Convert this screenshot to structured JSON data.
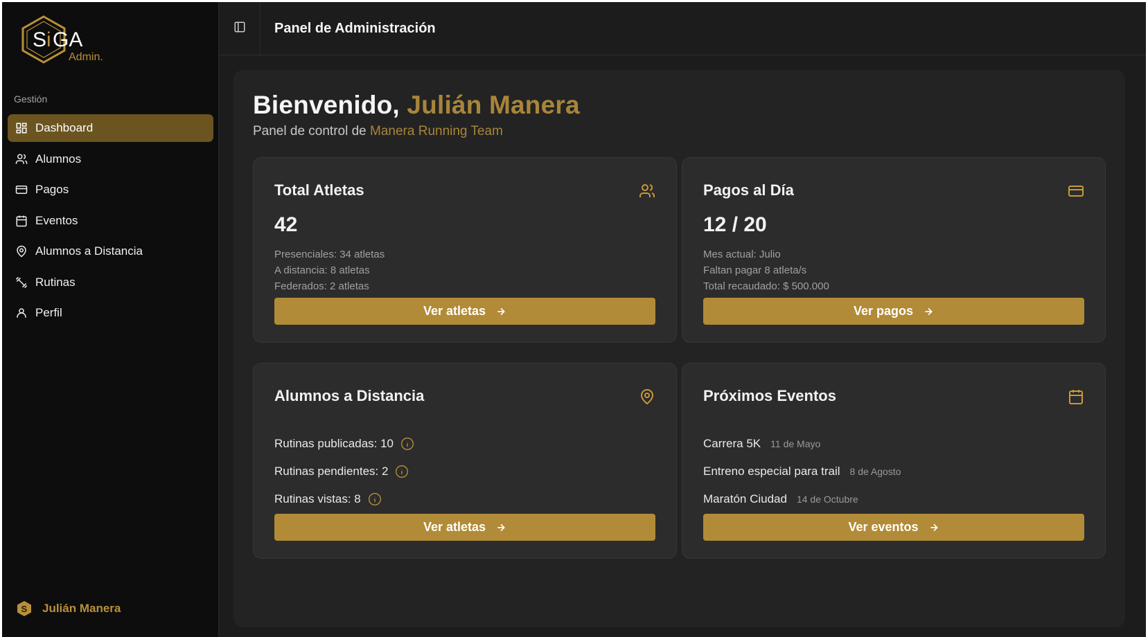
{
  "sidebar": {
    "logo_text": "SiGA",
    "logo_sub": "Admin.",
    "group_label": "Gestión",
    "items": [
      {
        "label": "Dashboard",
        "icon": "grid-icon",
        "active": true
      },
      {
        "label": "Alumnos",
        "icon": "users-icon"
      },
      {
        "label": "Pagos",
        "icon": "credit-card-icon"
      },
      {
        "label": "Eventos",
        "icon": "calendar-icon"
      },
      {
        "label": "Alumnos a Distancia",
        "icon": "map-pin-icon"
      },
      {
        "label": "Rutinas",
        "icon": "dumbbell-icon"
      },
      {
        "label": "Perfil",
        "icon": "user-icon"
      }
    ],
    "user_name": "Julián Manera"
  },
  "header": {
    "title": "Panel de Administración"
  },
  "welcome": {
    "greeting": "Bienvenido,",
    "name": "Julián Manera",
    "subtitle_prefix": "Panel de control de",
    "team": "Manera Running Team"
  },
  "cards": {
    "athletes": {
      "title": "Total Atletas",
      "value": "42",
      "lines": [
        "Presenciales: 34 atletas",
        "A distancia: 8 atletas",
        "Federados: 2 atletas"
      ],
      "button": "Ver atletas"
    },
    "payments": {
      "title": "Pagos al Día",
      "value": "12 / 20",
      "lines": [
        "Mes actual: Julio",
        "Faltan pagar 8 atleta/s",
        "Total recaudado: $ 500.000"
      ],
      "button": "Ver pagos"
    },
    "remote": {
      "title": "Alumnos a Distancia",
      "rows": [
        "Rutinas publicadas: 10",
        "Rutinas pendientes: 2",
        "Rutinas vistas: 8"
      ],
      "button": "Ver atletas"
    },
    "events": {
      "title": "Próximos Eventos",
      "rows": [
        {
          "name": "Carrera 5K",
          "date": "11 de Mayo"
        },
        {
          "name": "Entreno especial para trail",
          "date": "8 de Agosto"
        },
        {
          "name": "Maratón Ciudad",
          "date": "14 de Octubre"
        }
      ],
      "button": "Ver eventos"
    }
  },
  "colors": {
    "accent": "#b28b38",
    "active_nav": "#6b5420",
    "sidebar_bg": "#0d0d0d"
  }
}
